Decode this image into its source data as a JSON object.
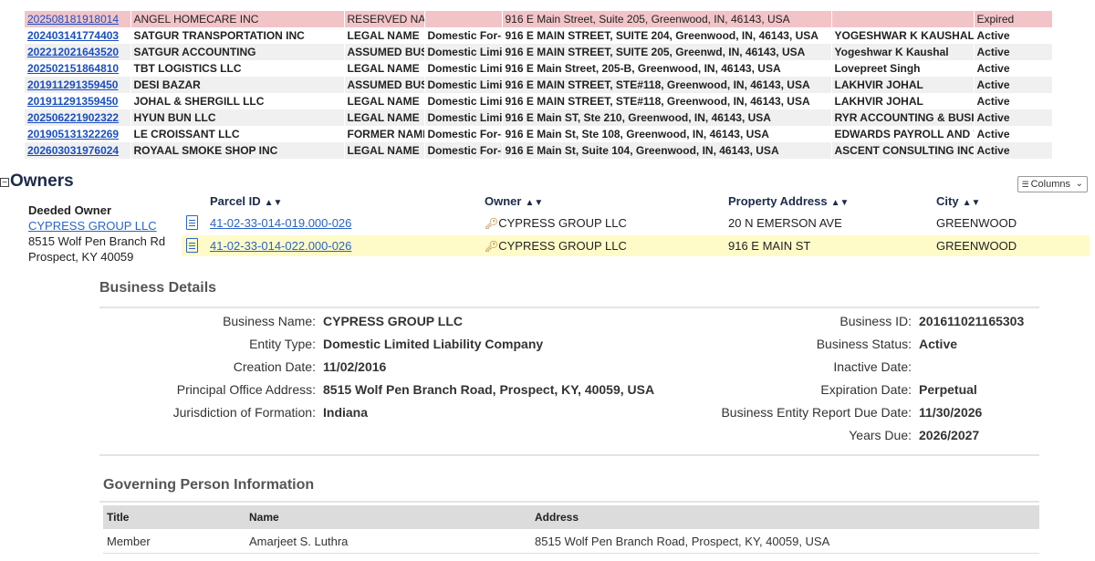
{
  "business_table": {
    "rows": [
      {
        "id": "202508181918014",
        "name": "ANGEL HOMECARE INC",
        "name_type": "RESERVED NAME",
        "entity": "",
        "address": "916 E Main Street, Suite 205, Greenwood, IN, 46143, USA",
        "agent": "",
        "status": "Expired"
      },
      {
        "id": "202403141774403",
        "name": "SATGUR TRANSPORTATION INC",
        "name_type": "LEGAL NAME",
        "entity": "Domestic For-P",
        "address": "916 E MAIN STREET, SUITE 204, Greenwood, IN, 46143, USA",
        "agent": "YOGESHWAR K KAUSHAL",
        "status": "Active"
      },
      {
        "id": "202212021643520",
        "name": "SATGUR ACCOUNTING",
        "name_type": "ASSUMED BUS",
        "entity": "Domestic Limit",
        "address": "916 E MAIN STREET, SUITE 205, Greenwd, IN, 46143, USA",
        "agent": "Yogeshwar K Kaushal",
        "status": "Active"
      },
      {
        "id": "202502151864810",
        "name": "TBT LOGISTICS LLC",
        "name_type": "LEGAL NAME",
        "entity": "Domestic Limit",
        "address": "916 E Main Street, 205-B, Greenwood, IN, 46143, USA",
        "agent": "Lovepreet Singh",
        "status": "Active"
      },
      {
        "id": "201911291359450",
        "name": "DESI BAZAR",
        "name_type": "ASSUMED BUS",
        "entity": "Domestic Limit",
        "address": "916 E MAIN STREET, STE#118, Greenwood, IN, 46143, USA",
        "agent": "LAKHVIR JOHAL",
        "status": "Active"
      },
      {
        "id": "201911291359450",
        "name": "JOHAL & SHERGILL LLC",
        "name_type": "LEGAL NAME",
        "entity": "Domestic Limit",
        "address": "916 E MAIN STREET, STE#118, Greenwood, IN, 46143, USA",
        "agent": "LAKHVIR JOHAL",
        "status": "Active"
      },
      {
        "id": "202506221902322",
        "name": "HYUN BUN LLC",
        "name_type": "LEGAL NAME",
        "entity": "Domestic Limit",
        "address": "916 E Main ST, Ste 210, Greenwood, IN, 46143, USA",
        "agent": "RYR ACCOUNTING & BUSIN",
        "status": "Active"
      },
      {
        "id": "201905131322269",
        "name": "LE CROISSANT LLC",
        "name_type": "FORMER NAME",
        "entity": "Domestic For-P",
        "address": "916 E Main St, Ste 108, Greenwood, IN, 46143, USA",
        "agent": "EDWARDS PAYROLL AND T",
        "status": "Active"
      },
      {
        "id": "202603031976024",
        "name": "ROYAAL SMOKE SHOP INC",
        "name_type": "LEGAL NAME",
        "entity": "Domestic For-P",
        "address": "916 E Main St, Suite 104, Greenwood, IN, 46143, USA",
        "agent": "ASCENT CONSULTING INC",
        "status": "Active"
      }
    ]
  },
  "owners": {
    "collapse_glyph": "−",
    "title": "Owners",
    "columns_button": "Columns",
    "deeded": {
      "label": "Deeded Owner",
      "name": "CYPRESS GROUP LLC",
      "address1": "8515 Wolf Pen Branch Rd",
      "address2": "Prospect, KY 40059"
    },
    "headers": {
      "parcel": "Parcel ID",
      "owner": "Owner",
      "address": "Property Address",
      "city": "City"
    },
    "parcels": [
      {
        "parcel_id": "41-02-33-014-019.000-026",
        "owner": "CYPRESS GROUP LLC",
        "address": "20 N EMERSON AVE",
        "city": "GREENWOOD",
        "highlighted": false
      },
      {
        "parcel_id": "41-02-33-014-022.000-026",
        "owner": "CYPRESS GROUP LLC",
        "address": "916 E MAIN ST",
        "city": "GREENWOOD",
        "highlighted": true
      }
    ]
  },
  "business_details": {
    "title": "Business Details",
    "left": [
      {
        "label": "Business Name:",
        "value": "CYPRESS GROUP LLC"
      },
      {
        "label": "Entity Type:",
        "value": "Domestic Limited Liability Company"
      },
      {
        "label": "Creation Date:",
        "value": "11/02/2016"
      },
      {
        "label": "Principal Office Address:",
        "value": "8515 Wolf Pen Branch Road, Prospect, KY, 40059, USA"
      },
      {
        "label": "Jurisdiction of Formation:",
        "value": "Indiana"
      }
    ],
    "right": [
      {
        "label": "Business ID:",
        "value": "201611021165303"
      },
      {
        "label": "Business Status:",
        "value": "Active"
      },
      {
        "label": "Inactive Date:",
        "value": ""
      },
      {
        "label": "Expiration Date:",
        "value": "Perpetual"
      },
      {
        "label": "Business Entity Report Due Date:",
        "value": "11/30/2026"
      },
      {
        "label": "Years Due:",
        "value": "2026/2027"
      }
    ]
  },
  "governing": {
    "title": "Governing Person Information",
    "headers": {
      "title": "Title",
      "name": "Name",
      "address": "Address"
    },
    "rows": [
      {
        "title": "Member",
        "name": "Amarjeet S. Luthra",
        "address": "8515 Wolf Pen Branch Road, Prospect, KY, 40059, USA"
      }
    ]
  }
}
